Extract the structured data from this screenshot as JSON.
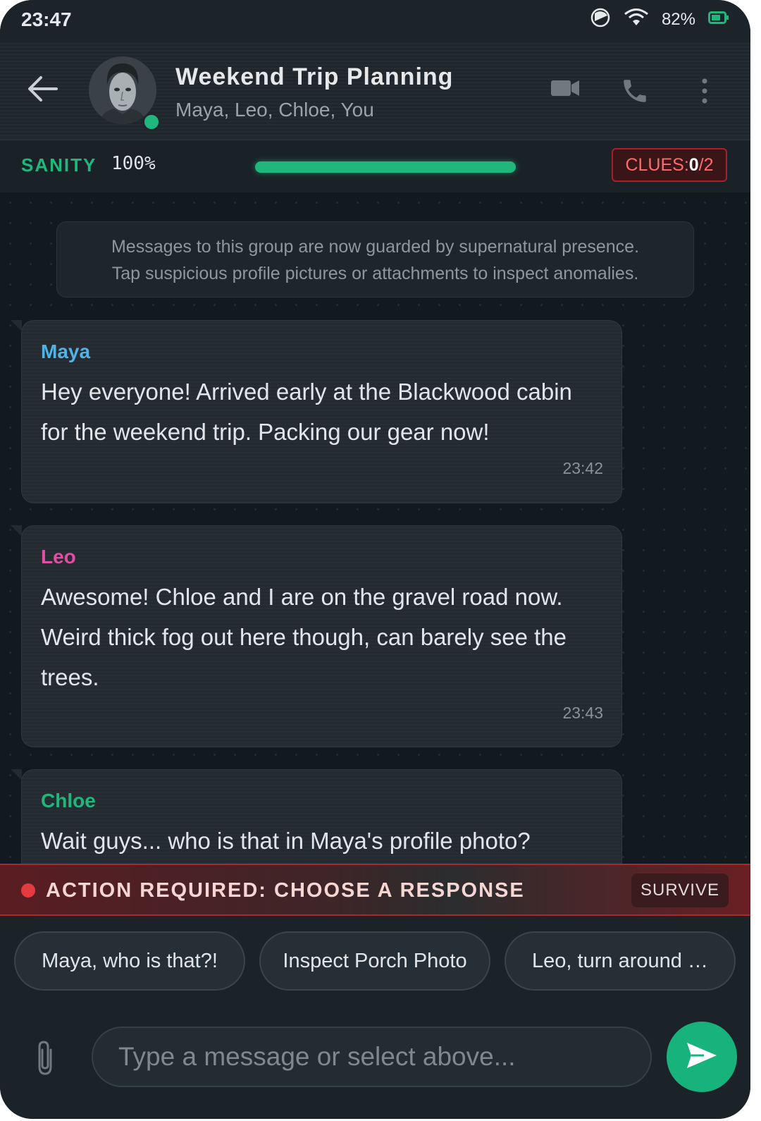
{
  "status_bar": {
    "time": "23:47",
    "battery_percent": "82%",
    "battery_level": 0.82,
    "icons": [
      "do-not-disturb-icon",
      "wifi-icon",
      "battery-icon"
    ]
  },
  "header": {
    "title": "Weekend Trip Planning",
    "members": "Maya, Leo, Chloe, You",
    "icons": [
      "back-arrow-icon",
      "video-call-icon",
      "phone-icon",
      "more-vert-icon"
    ]
  },
  "sanity": {
    "label": "SANITY",
    "value_text": "100%",
    "level": 1.0,
    "color": "#1fb77c"
  },
  "clues": {
    "prefix": "CLUES: ",
    "found": "0",
    "suffix": "/2"
  },
  "notice": {
    "line1": "Messages to this group are now guarded by supernatural presence.",
    "line2": "Tap suspicious profile pictures or attachments to inspect anomalies."
  },
  "messages": [
    {
      "sender": "Maya",
      "color": "#4fb3e8",
      "text": "Hey everyone! Arrived early at the Blackwood cabin for the weekend trip. Packing our gear now!",
      "time": "23:42"
    },
    {
      "sender": "Leo",
      "color": "#e14ea4",
      "text": "Awesome! Chloe and I are on the gravel road now. Weird thick fog out here though, can barely see the trees.",
      "time": "23:43"
    },
    {
      "sender": "Chloe",
      "color": "#1fb77c",
      "text": "Wait guys... who is that in Maya's profile photo?"
    }
  ],
  "action": {
    "text": "ACTION REQUIRED: CHOOSE A RESPONSE",
    "mode": "SURVIVE"
  },
  "responses": [
    "Maya, who is that?!",
    "Inspect Porch Photo",
    "Leo, turn around …"
  ],
  "input": {
    "placeholder": "Type a message or select above..."
  }
}
